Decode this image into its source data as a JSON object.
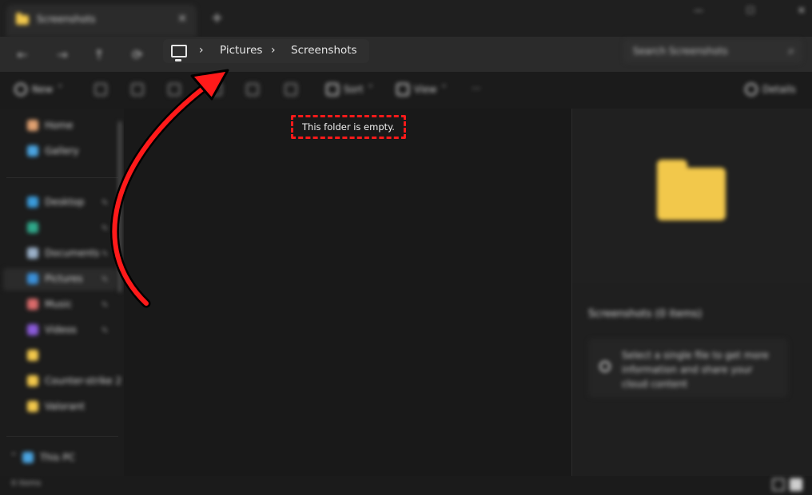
{
  "window": {
    "tab_title": "Screenshots",
    "new_tab": "+",
    "controls": [
      "—",
      "☐",
      "✕"
    ]
  },
  "nav": {
    "back": "←",
    "forward": "→",
    "up": "↑",
    "refresh": "⟳"
  },
  "breadcrumb": {
    "pc_icon": "monitor-icon",
    "items": [
      "Pictures",
      "Screenshots"
    ]
  },
  "search": {
    "placeholder": "Search Screenshots"
  },
  "toolbar": {
    "new_label": "New",
    "sort_label": "Sort",
    "view_label": "View",
    "more_label": "···",
    "details_label": "Details"
  },
  "sidebar": {
    "items": [
      {
        "label": "Home"
      },
      {
        "label": "Gallery"
      },
      {
        "label": "Desktop"
      },
      {
        "label": "Documents"
      },
      {
        "label": "Pictures"
      },
      {
        "label": "Music"
      },
      {
        "label": "Videos"
      },
      {
        "label": "Counter-strike 2"
      },
      {
        "label": "Valorant"
      },
      {
        "label": "This PC"
      }
    ]
  },
  "main": {
    "empty_message": "This folder is empty."
  },
  "details": {
    "title": "Screenshots (0 items)",
    "info_text": "Select a single file to get more information and share your cloud content"
  },
  "status": {
    "items_count": "0 items"
  },
  "annotation": {
    "arrow_color": "#ff1a1a"
  }
}
